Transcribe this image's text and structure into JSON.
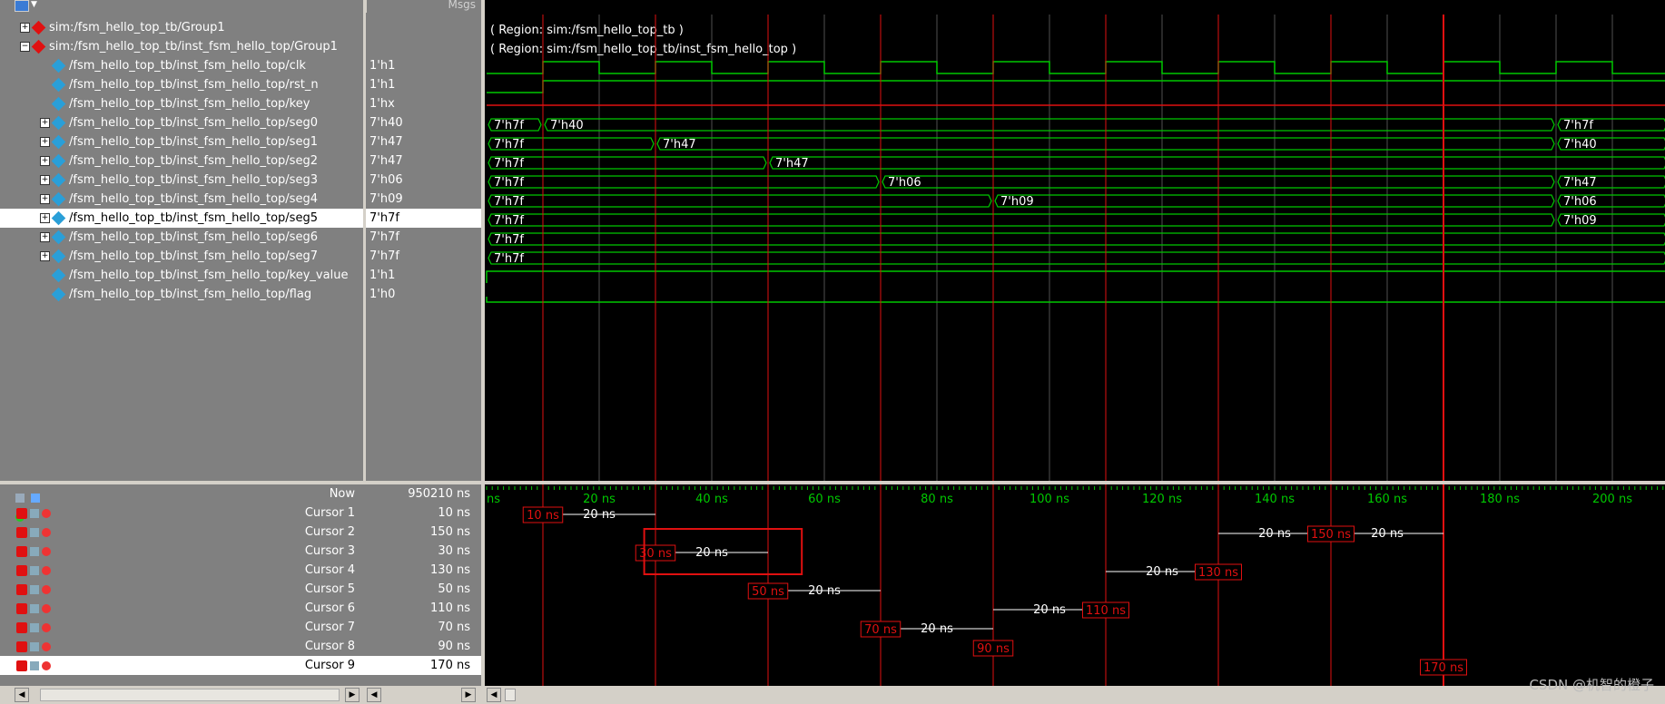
{
  "header": {
    "msgs_label": "Msgs"
  },
  "signals": [
    {
      "name": "sim:/fsm_hello_top_tb/Group1",
      "value": "",
      "type": "group",
      "expand": "+",
      "indent": 0
    },
    {
      "name": "sim:/fsm_hello_top_tb/inst_fsm_hello_top/Group1",
      "value": "",
      "type": "group",
      "expand": "−",
      "indent": 0
    },
    {
      "name": "/fsm_hello_top_tb/inst_fsm_hello_top/clk",
      "value": "1'h1",
      "type": "bit",
      "expand": "",
      "indent": 1
    },
    {
      "name": "/fsm_hello_top_tb/inst_fsm_hello_top/rst_n",
      "value": "1'h1",
      "type": "bit",
      "expand": "",
      "indent": 1
    },
    {
      "name": "/fsm_hello_top_tb/inst_fsm_hello_top/key",
      "value": "1'hx",
      "type": "bit",
      "expand": "",
      "indent": 1
    },
    {
      "name": "/fsm_hello_top_tb/inst_fsm_hello_top/seg0",
      "value": "7'h40",
      "type": "bus",
      "expand": "+",
      "indent": 1
    },
    {
      "name": "/fsm_hello_top_tb/inst_fsm_hello_top/seg1",
      "value": "7'h47",
      "type": "bus",
      "expand": "+",
      "indent": 1
    },
    {
      "name": "/fsm_hello_top_tb/inst_fsm_hello_top/seg2",
      "value": "7'h47",
      "type": "bus",
      "expand": "+",
      "indent": 1
    },
    {
      "name": "/fsm_hello_top_tb/inst_fsm_hello_top/seg3",
      "value": "7'h06",
      "type": "bus",
      "expand": "+",
      "indent": 1
    },
    {
      "name": "/fsm_hello_top_tb/inst_fsm_hello_top/seg4",
      "value": "7'h09",
      "type": "bus",
      "expand": "+",
      "indent": 1
    },
    {
      "name": "/fsm_hello_top_tb/inst_fsm_hello_top/seg5",
      "value": "7'h7f",
      "type": "bus",
      "expand": "+",
      "indent": 1,
      "selected": true
    },
    {
      "name": "/fsm_hello_top_tb/inst_fsm_hello_top/seg6",
      "value": "7'h7f",
      "type": "bus",
      "expand": "+",
      "indent": 1
    },
    {
      "name": "/fsm_hello_top_tb/inst_fsm_hello_top/seg7",
      "value": "7'h7f",
      "type": "bus",
      "expand": "+",
      "indent": 1
    },
    {
      "name": "/fsm_hello_top_tb/inst_fsm_hello_top/key_value",
      "value": "1'h1",
      "type": "bit",
      "expand": "",
      "indent": 1
    },
    {
      "name": "/fsm_hello_top_tb/inst_fsm_hello_top/flag",
      "value": "1'h0",
      "type": "bit",
      "expand": "",
      "indent": 1
    }
  ],
  "group_labels": [
    "( Region: sim:/fsm_hello_top_tb )",
    "( Region: sim:/fsm_hello_top_tb/inst_fsm_hello_top )"
  ],
  "timeline": {
    "ns_per_period": 20,
    "ticks": [
      "20 ns",
      "40 ns",
      "60 ns",
      "80 ns",
      "100 ns",
      "120 ns",
      "140 ns",
      "160 ns",
      "180 ns",
      "200 ns"
    ],
    "left_unit": "ns"
  },
  "now": {
    "label": "Now",
    "value": "950210 ns"
  },
  "cursors": [
    {
      "label": "Cursor 1",
      "value": "10 ns",
      "time": 10
    },
    {
      "label": "Cursor 2",
      "value": "150 ns",
      "time": 150
    },
    {
      "label": "Cursor 3",
      "value": "30 ns",
      "time": 30
    },
    {
      "label": "Cursor 4",
      "value": "130 ns",
      "time": 130
    },
    {
      "label": "Cursor 5",
      "value": "50 ns",
      "time": 50
    },
    {
      "label": "Cursor 6",
      "value": "110 ns",
      "time": 110
    },
    {
      "label": "Cursor 7",
      "value": "70 ns",
      "time": 70
    },
    {
      "label": "Cursor 8",
      "value": "90 ns",
      "time": 90
    },
    {
      "label": "Cursor 9",
      "value": "170 ns",
      "time": 170,
      "selected": true
    }
  ],
  "bus_segments": {
    "seg0": [
      [
        "7'h7f",
        0
      ],
      [
        "7'h40",
        10
      ],
      [
        "7'h7f",
        190
      ]
    ],
    "seg1": [
      [
        "7'h7f",
        0
      ],
      [
        "7'h47",
        30
      ],
      [
        "7'h40",
        190
      ]
    ],
    "seg2": [
      [
        "7'h7f",
        0
      ],
      [
        "7'h47",
        50
      ]
    ],
    "seg3": [
      [
        "7'h7f",
        0
      ],
      [
        "7'h06",
        70
      ],
      [
        "7'h47",
        190
      ]
    ],
    "seg4": [
      [
        "7'h7f",
        0
      ],
      [
        "7'h09",
        90
      ],
      [
        "7'h06",
        190
      ]
    ],
    "seg5": [
      [
        "7'h7f",
        0
      ],
      [
        "7'h09",
        190
      ]
    ],
    "seg6": [
      [
        "7'h7f",
        0
      ]
    ],
    "seg7": [
      [
        "7'h7f",
        0
      ]
    ]
  },
  "cursor_deltas": [
    {
      "label": "20 ns"
    },
    {
      "label": "20 ns"
    },
    {
      "label": "20 ns"
    },
    {
      "label": "20 ns"
    },
    {
      "label": "20 ns"
    },
    {
      "label": "20 ns"
    },
    {
      "label": "20 ns"
    },
    {
      "label": "20 ns"
    }
  ],
  "watermark": "CSDN @机智的橙子",
  "colors": {
    "wave": "#00c800",
    "cursor": "#e01010",
    "grid": "#505050",
    "bus_text": "#ffffff"
  }
}
